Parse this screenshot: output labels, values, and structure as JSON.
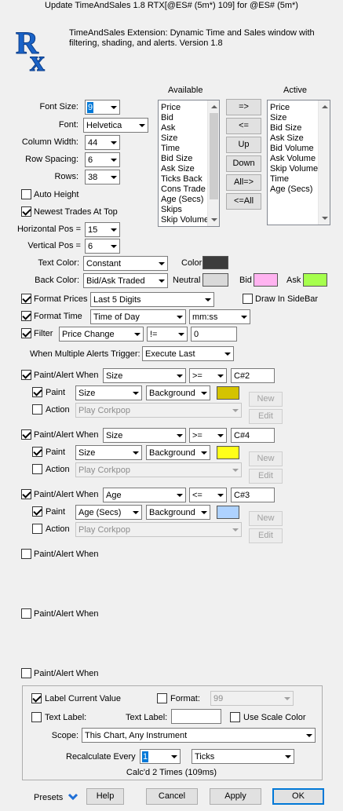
{
  "window": {
    "title": "Update TimeAndSales 1.8 RTX[@ES# (5m*) 109] for @ES# (5m*)"
  },
  "header": {
    "logo_text": "RX",
    "description": "TimeAndSales Extension: Dynamic Time and Sales window with filtering, shading, and alerts. Version 1.8"
  },
  "settings": {
    "font_size": {
      "label": "Font Size:",
      "value": "9"
    },
    "font": {
      "label": "Font:",
      "value": "Helvetica"
    },
    "column_width": {
      "label": "Column Width:",
      "value": "44"
    },
    "row_spacing": {
      "label": "Row Spacing:",
      "value": "6"
    },
    "rows": {
      "label": "Rows:",
      "value": "38"
    },
    "auto_height": {
      "label": "Auto Height",
      "checked": false
    },
    "newest_at_top": {
      "label": "Newest Trades At Top",
      "checked": true
    },
    "horizontal_pos": {
      "label": "Horizontal Pos =",
      "value": "15"
    },
    "vertical_pos": {
      "label": "Vertical Pos =",
      "value": "6"
    }
  },
  "columns": {
    "available_label": "Available",
    "active_label": "Active",
    "available": [
      "Price",
      "Bid",
      "Ask",
      "Size",
      "Time",
      "Bid Size",
      "Ask Size",
      "Ticks Back",
      "Cons Trade",
      "Age (Secs)",
      "Skips",
      "Skip Volume"
    ],
    "active": [
      "Price",
      "Size",
      "Bid Size",
      "Ask Size",
      "Bid Volume",
      "Ask Volume",
      "Skip Volume",
      "Time",
      "Age (Secs)"
    ],
    "buttons": {
      "add": "=>",
      "remove": "<=",
      "up": "Up",
      "down": "Down",
      "all_add": "All=>",
      "all_remove": "<=All"
    }
  },
  "colors": {
    "text_color": {
      "label": "Text Color:",
      "value": "Constant",
      "color_label": "Color",
      "swatch": "#3c3c3c"
    },
    "back_color": {
      "label": "Back Color:",
      "value": "Bid/Ask Traded",
      "neutral_label": "Neutral",
      "neutral_swatch": "#d9d9d9",
      "bid_label": "Bid",
      "bid_swatch": "#ffb3f0",
      "ask_label": "Ask",
      "ask_swatch": "#a6ff4d"
    }
  },
  "format": {
    "prices": {
      "label": "Format Prices",
      "checked": true,
      "value": "Last 5 Digits"
    },
    "draw_sidebar": {
      "label": "Draw In SideBar",
      "checked": false
    },
    "time": {
      "label": "Format Time",
      "checked": true,
      "value": "Time of Day",
      "format": "mm:ss"
    },
    "filter": {
      "label": "Filter",
      "checked": true,
      "field": "Price Change",
      "op": "!=",
      "value": "0"
    },
    "multi_alerts": {
      "label": "When Multiple Alerts Trigger:",
      "value": "Execute Last"
    }
  },
  "alerts": [
    {
      "label": "Paint/Alert When",
      "checked": true,
      "field": "Size",
      "op": ">=",
      "value": "C#2",
      "paint_label": "Paint",
      "paint_checked": true,
      "paint_field": "Size",
      "paint_target": "Background",
      "swatch": "#d4c300",
      "action_label": "Action",
      "action_checked": false,
      "action_value": "Play Corkpop",
      "new_label": "New",
      "edit_label": "Edit"
    },
    {
      "label": "Paint/Alert When",
      "checked": true,
      "field": "Size",
      "op": ">=",
      "value": "C#4",
      "paint_label": "Paint",
      "paint_checked": true,
      "paint_field": "Size",
      "paint_target": "Background",
      "swatch": "#ffff1a",
      "action_label": "Action",
      "action_checked": false,
      "action_value": "Play Corkpop",
      "new_label": "New",
      "edit_label": "Edit"
    },
    {
      "label": "Paint/Alert When",
      "checked": true,
      "field": "Age",
      "op": "<=",
      "value": "C#3",
      "paint_label": "Paint",
      "paint_checked": true,
      "paint_field": "Age (Secs)",
      "paint_target": "Background",
      "swatch": "#aed2ff",
      "action_label": "Action",
      "action_checked": false,
      "action_value": "Play Corkpop",
      "new_label": "New",
      "edit_label": "Edit"
    },
    {
      "label": "Paint/Alert When",
      "checked": false
    },
    {
      "label": "Paint/Alert When",
      "checked": false
    },
    {
      "label": "Paint/Alert When",
      "checked": false
    }
  ],
  "label_group": {
    "label_current_value": {
      "label": "Label Current Value",
      "checked": true
    },
    "format": {
      "label": "Format:",
      "checked": false,
      "value": "99"
    },
    "text_label_cb": {
      "label": "Text Label:",
      "checked": false
    },
    "text_label_field": {
      "label": "Text Label:",
      "value": ""
    },
    "use_scale_color": {
      "label": "Use Scale Color",
      "checked": false
    },
    "scope": {
      "label": "Scope:",
      "value": "This Chart, Any Instrument"
    },
    "recalc": {
      "label": "Recalculate Every",
      "value": "1",
      "unit": "Ticks"
    },
    "status": "Calc'd 2 Times (109ms)"
  },
  "footer": {
    "presets": "Presets",
    "help": "Help",
    "cancel": "Cancel",
    "apply": "Apply",
    "ok": "OK"
  }
}
